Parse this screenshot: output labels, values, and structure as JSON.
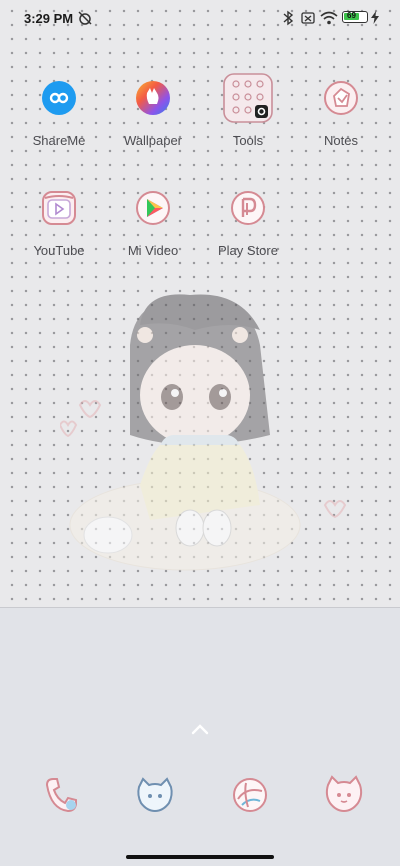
{
  "status_bar": {
    "time": "3:29 PM",
    "battery_level": "69"
  },
  "apps": [
    {
      "name": "ShareMe",
      "icon": "shareme-icon"
    },
    {
      "name": "Wallpaper",
      "icon": "wallpaper-icon"
    },
    {
      "name": "Tools",
      "icon": "tools-folder-icon"
    },
    {
      "name": "Notes",
      "icon": "notes-icon"
    },
    {
      "name": "YouTube",
      "icon": "youtube-icon"
    },
    {
      "name": "Mi Video",
      "icon": "mi-video-icon"
    },
    {
      "name": "Play Store",
      "icon": "play-store-icon"
    }
  ],
  "dock": [
    {
      "icon": "phone-icon"
    },
    {
      "icon": "messages-icon"
    },
    {
      "icon": "browser-icon"
    },
    {
      "icon": "camera-icon"
    }
  ],
  "colors": {
    "accent_pink": "#d58a93",
    "share_blue": "#1e9bf0"
  }
}
